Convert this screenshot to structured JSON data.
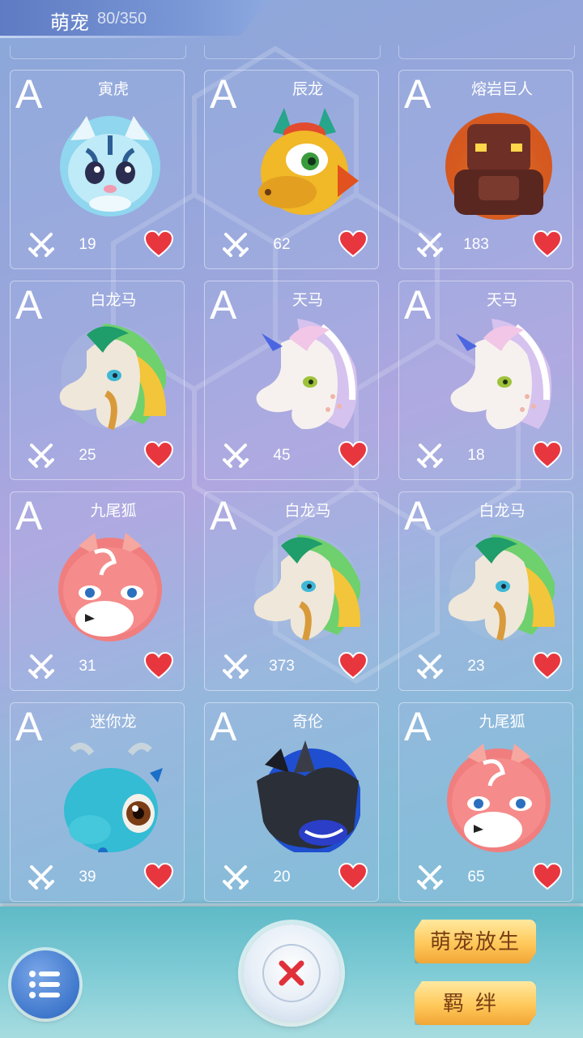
{
  "header": {
    "title": "萌宠",
    "count": "80/350"
  },
  "pets": [
    {
      "grade": "A",
      "name": "寅虎",
      "attack": "19",
      "kind": "tiger"
    },
    {
      "grade": "A",
      "name": "辰龙",
      "attack": "62",
      "kind": "dragon"
    },
    {
      "grade": "A",
      "name": "熔岩巨人",
      "attack": "183",
      "kind": "golem"
    },
    {
      "grade": "A",
      "name": "白龙马",
      "attack": "25",
      "kind": "horse"
    },
    {
      "grade": "A",
      "name": "天马",
      "attack": "45",
      "kind": "unicorn"
    },
    {
      "grade": "A",
      "name": "天马",
      "attack": "18",
      "kind": "unicorn"
    },
    {
      "grade": "A",
      "name": "九尾狐",
      "attack": "31",
      "kind": "fox"
    },
    {
      "grade": "A",
      "name": "白龙马",
      "attack": "373",
      "kind": "horse"
    },
    {
      "grade": "A",
      "name": "白龙马",
      "attack": "23",
      "kind": "horse"
    },
    {
      "grade": "A",
      "name": "迷你龙",
      "attack": "39",
      "kind": "minidragon"
    },
    {
      "grade": "A",
      "name": "奇伦",
      "attack": "20",
      "kind": "qilin"
    },
    {
      "grade": "A",
      "name": "九尾狐",
      "attack": "65",
      "kind": "fox"
    }
  ],
  "bottom": {
    "release_label": "萌宠放生",
    "bond_label": "羁绊",
    "menu_icon": "list-icon",
    "close_icon": "close-icon"
  },
  "colors": {
    "heart": "#e8363f",
    "close_x": "#e0313b",
    "gold": "#ffc85a"
  }
}
